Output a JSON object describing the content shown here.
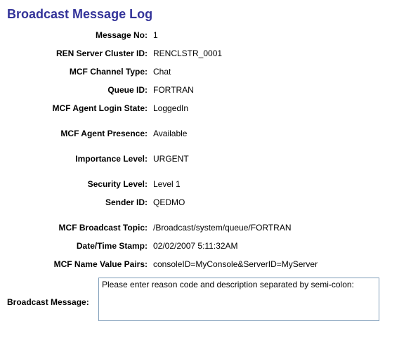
{
  "title": "Broadcast Message Log",
  "fields": {
    "message_no": {
      "label": "Message No:",
      "value": "1"
    },
    "ren_cluster": {
      "label": "REN Server Cluster ID:",
      "value": "RENCLSTR_0001"
    },
    "channel_type": {
      "label": "MCF Channel Type:",
      "value": "Chat"
    },
    "queue_id": {
      "label": "Queue ID:",
      "value": "FORTRAN"
    },
    "login_state": {
      "label": "MCF Agent Login State:",
      "value": "LoggedIn"
    },
    "presence": {
      "label": "MCF Agent Presence:",
      "value": "Available"
    },
    "importance": {
      "label": "Importance Level:",
      "value": "URGENT"
    },
    "security": {
      "label": "Security Level:",
      "value": "Level 1"
    },
    "sender_id": {
      "label": "Sender ID:",
      "value": "QEDMO"
    },
    "broadcast_topic": {
      "label": "MCF Broadcast Topic:",
      "value": "/Broadcast/system/queue/FORTRAN"
    },
    "datetime": {
      "label": "Date/Time Stamp:",
      "value": "02/02/2007  5:11:32AM"
    },
    "nv_pairs": {
      "label": "MCF Name Value Pairs:",
      "value": "consoleID=MyConsole&ServerID=MyServer"
    }
  },
  "message_box": {
    "label": "Broadcast Message:",
    "value": "Please enter reason code and description separated by semi-colon:"
  }
}
